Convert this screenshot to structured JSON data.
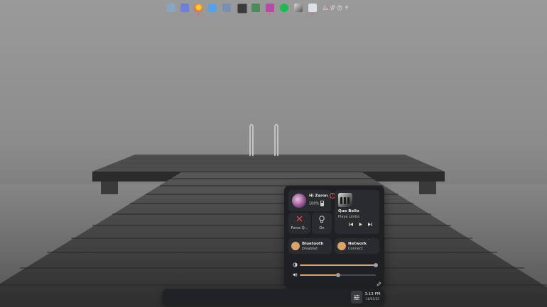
{
  "user": {
    "greeting": "Hi Zaron",
    "battery": "100%",
    "warning_icon": "alert-circle-icon"
  },
  "media": {
    "title": "Que Bello",
    "artist": "Playa Limbo",
    "controls": [
      "previous-icon",
      "play-icon",
      "next-icon"
    ]
  },
  "tiles": {
    "force_quit": {
      "label": "Force Q...",
      "icon": "close-icon"
    },
    "night_light": {
      "label": "On",
      "icon": "lightbulb-icon"
    },
    "bluetooth": {
      "title": "Bluetooth",
      "status": "Disabled"
    },
    "network": {
      "title": "Network",
      "status": "Connect"
    }
  },
  "sliders": {
    "brightness": 1.0,
    "volume": 0.5
  },
  "taskbar": {
    "apps": [
      "files",
      "window",
      "firefox",
      "folder",
      "image-viewer",
      "terminal",
      "spreadsheet",
      "document",
      "spotify",
      "inkscape",
      "notes"
    ],
    "tray": [
      "bell-icon",
      "paperclip-icon",
      "help-icon",
      "upload-icon"
    ],
    "clock": {
      "time": "3:13 PM",
      "date": "10/01/25"
    }
  },
  "colors": {
    "accent": "#d8a46c",
    "panel": "#1f2023",
    "tile": "#2a2b2f",
    "alert": "#e25555"
  }
}
